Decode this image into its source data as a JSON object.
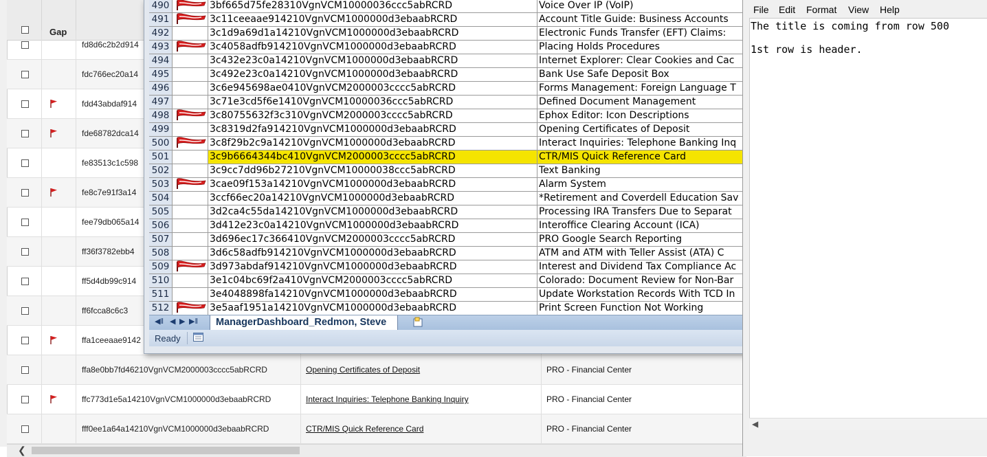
{
  "background_grid": {
    "header": {
      "gap_label": "Gap"
    },
    "rows": [
      {
        "id": "fd8d6c2b2d914",
        "title": "",
        "category": "",
        "flag": false
      },
      {
        "id": "fdc766ec20a14",
        "title": "",
        "category": "",
        "flag": false
      },
      {
        "id": "fdd43abdaf914",
        "title": "",
        "category": "",
        "flag": true
      },
      {
        "id": "fde68782dca14",
        "title": "",
        "category": "",
        "flag": true
      },
      {
        "id": "fe83513c1c598",
        "title": "",
        "category": "",
        "flag": false
      },
      {
        "id": "fe8c7e91f3a14",
        "title": "",
        "category": "",
        "flag": true
      },
      {
        "id": "fee79db065a14",
        "title": "",
        "category": "",
        "flag": false
      },
      {
        "id": "ff36f3782ebb4",
        "title": "",
        "category": "",
        "flag": false
      },
      {
        "id": "ff5d4db99c914",
        "title": "",
        "category": "",
        "flag": false
      },
      {
        "id": "ff6fcca8c6c3",
        "title": "",
        "category": "",
        "flag": false
      },
      {
        "id": "ffa1ceeaae9142",
        "title": "",
        "category": "",
        "flag": true
      },
      {
        "id": "ffa8e0bb7fd46210VgnVCM2000003cccc5abRCRD",
        "title": "Opening Certificates of Deposit",
        "category": "PRO - Financial Center",
        "flag": false
      },
      {
        "id": "ffc773d1e5a14210VgnVCM1000000d3ebaabRCRD",
        "title": "Interact Inquiries: Telephone Banking Inquiry",
        "category": "PRO - Financial Center",
        "flag": true
      },
      {
        "id": "fff0ee1a64a14210VgnVCM1000000d3ebaabRCRD",
        "title": "CTR/MIS Quick Reference Card",
        "category": "PRO - Financial Center",
        "flag": false
      }
    ]
  },
  "excel": {
    "highlight_color": "#f5e400",
    "rows": [
      {
        "num": "490",
        "id": "3bf665d75fe28310VgnVCM10000036ccc5abRCRD",
        "title": "Voice Over IP (VoIP)",
        "flag": true
      },
      {
        "num": "491",
        "id": "3c11ceeaae914210VgnVCM1000000d3ebaabRCRD",
        "title": "Account Title Guide: Business Accounts",
        "flag": true
      },
      {
        "num": "492",
        "id": "3c1d9a69d1a14210VgnVCM1000000d3ebaabRCRD",
        "title": "Electronic Funds Transfer (EFT) Claims:",
        "flag": false
      },
      {
        "num": "493",
        "id": "3c4058adfb914210VgnVCM1000000d3ebaabRCRD",
        "title": "Placing Holds Procedures",
        "flag": true
      },
      {
        "num": "494",
        "id": "3c432e23c0a14210VgnVCM1000000d3ebaabRCRD",
        "title": "Internet Explorer:  Clear Cookies and Cac",
        "flag": false
      },
      {
        "num": "495",
        "id": "3c492e23c0a14210VgnVCM1000000d3ebaabRCRD",
        "title": "Bank Use Safe Deposit Box",
        "flag": false
      },
      {
        "num": "496",
        "id": "3c6e945698ae0410VgnVCM2000003cccc5abRCRD",
        "title": "Forms Management: Foreign Language T",
        "flag": false
      },
      {
        "num": "497",
        "id": "3c71e3cd5f6e1410VgnVCM10000036ccc5abRCRD",
        "title": "Defined Document Management",
        "flag": false
      },
      {
        "num": "498",
        "id": "3c80755632f3c310VgnVCM2000003cccc5abRCRD",
        "title": "Ephox Editor: Icon Descriptions",
        "flag": true
      },
      {
        "num": "499",
        "id": "3c8319d2fa914210VgnVCM1000000d3ebaabRCRD",
        "title": "Opening Certificates of Deposit",
        "flag": false
      },
      {
        "num": "500",
        "id": "3c8f29b2c9a14210VgnVCM1000000d3ebaabRCRD",
        "title": "Interact Inquiries: Telephone Banking Inq",
        "flag": true
      },
      {
        "num": "501",
        "id": "3c9b6664344bc410VgnVCM2000003cccc5abRCRD",
        "title": "CTR/MIS Quick Reference Card",
        "flag": false,
        "highlight": true
      },
      {
        "num": "502",
        "id": "3c9cc7dd96b27210VgnVCM10000038ccc5abRCRD",
        "title": "Text Banking",
        "flag": false
      },
      {
        "num": "503",
        "id": "3cae09f153a14210VgnVCM1000000d3ebaabRCRD",
        "title": "Alarm System",
        "flag": true
      },
      {
        "num": "504",
        "id": "3ccf66ec20a14210VgnVCM1000000d3ebaabRCRD",
        "title": "*Retirement and Coverdell Education Sav",
        "flag": false
      },
      {
        "num": "505",
        "id": "3d2ca4c55da14210VgnVCM1000000d3ebaabRCRD",
        "title": "Processing IRA Transfers Due to Separat",
        "flag": false
      },
      {
        "num": "506",
        "id": "3d412e23c0a14210VgnVCM1000000d3ebaabRCRD",
        "title": "Interoffice Clearing Account (ICA)",
        "flag": false
      },
      {
        "num": "507",
        "id": "3d696ec17c366410VgnVCM2000003cccc5abRCRD",
        "title": "PRO Google Search Reporting",
        "flag": false
      },
      {
        "num": "508",
        "id": "3d6c58adfb914210VgnVCM1000000d3ebaabRCRD",
        "title": "ATM and ATM with Teller Assist (ATA) C",
        "flag": false
      },
      {
        "num": "509",
        "id": "3d973abdaf914210VgnVCM1000000d3ebaabRCRD",
        "title": "Interest and Dividend Tax Compliance Ac",
        "flag": true
      },
      {
        "num": "510",
        "id": "3e1c04bc69f2a410VgnVCM2000003cccc5abRCRD",
        "title": "Colorado: Document Review for Non-Bar",
        "flag": false
      },
      {
        "num": "511",
        "id": "3e4048898fa14210VgnVCM1000000d3ebaabRCRD",
        "title": "Update Workstation Records With TCD In",
        "flag": false
      },
      {
        "num": "512",
        "id": "3e5aaf1951a14210VgnVCM1000000d3ebaabRCRD",
        "title": "Print Screen Function Not Working",
        "flag": true
      }
    ],
    "sheet_tab": "ManagerDashboard_Redmon, Steve",
    "status": "Ready"
  },
  "notepad": {
    "menu": [
      "File",
      "Edit",
      "Format",
      "View",
      "Help"
    ],
    "lines": [
      "The title is coming from row 500",
      "",
      "1st row is header."
    ]
  }
}
